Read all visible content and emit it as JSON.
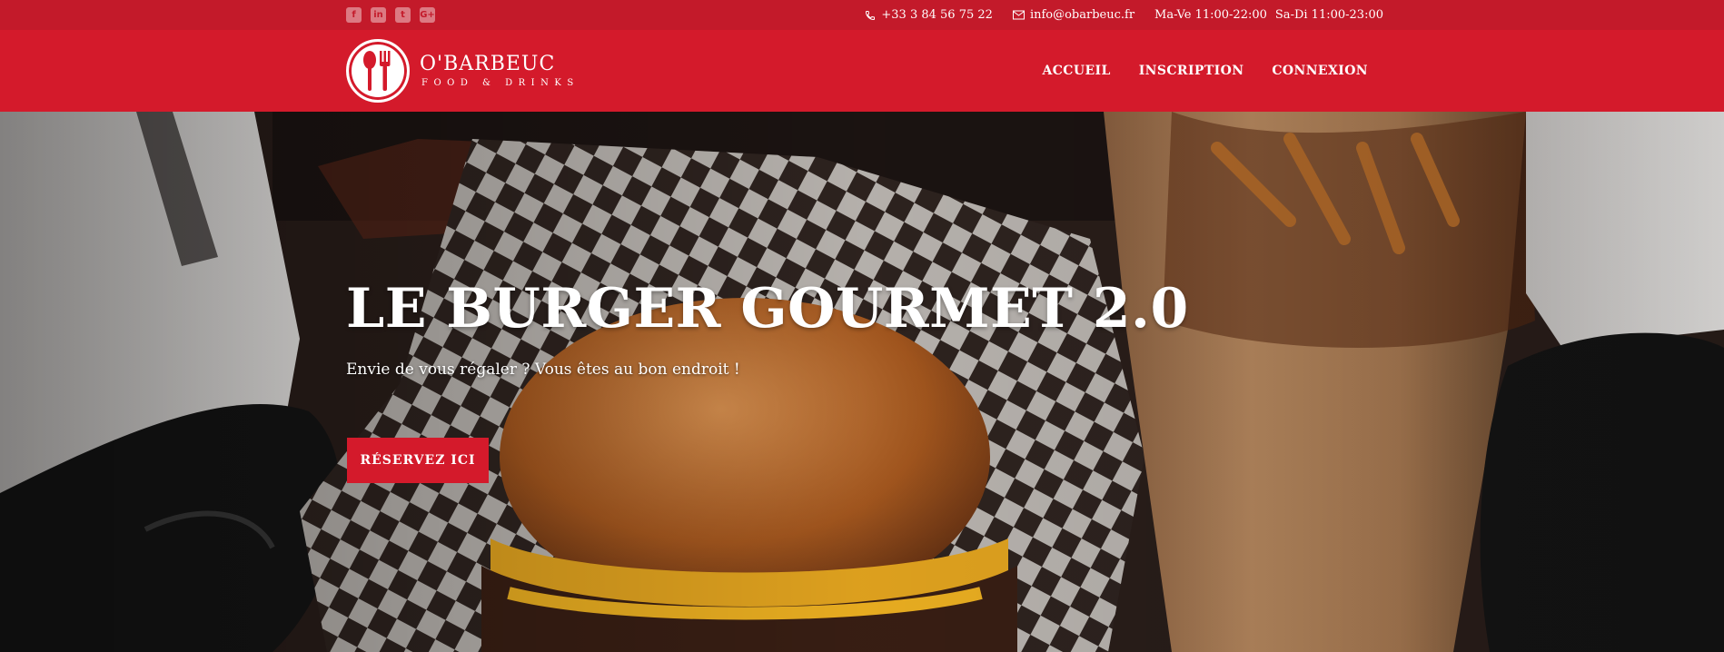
{
  "topbar": {
    "socials": [
      {
        "icon": "facebook-icon",
        "glyph": "f"
      },
      {
        "icon": "linkedin-icon",
        "glyph": "in"
      },
      {
        "icon": "twitter-icon",
        "glyph": "t"
      },
      {
        "icon": "google-plus-icon",
        "glyph": "G+"
      }
    ],
    "phone": "+33 3 84 56 75 22",
    "email": "info@obarbeuc.fr",
    "hours_week": "Ma-Ve 11:00-22:00",
    "hours_weekend": "Sa-Di 11:00-23:00"
  },
  "brand": {
    "name": "O'BARBEUC",
    "tagline": "FOOD & DRINKS"
  },
  "nav": {
    "items": [
      "ACCUEIL",
      "INSCRIPTION",
      "CONNEXION"
    ]
  },
  "hero": {
    "title": "LE BURGER GOURMET 2.0",
    "subtitle": "Envie de vous régaler ? Vous êtes au bon endroit !",
    "cta": "RÉSERVEZ ICI"
  },
  "colors": {
    "topbar": "#c31a2a",
    "navbar": "#d41a2b",
    "accent": "#d41a2b"
  }
}
